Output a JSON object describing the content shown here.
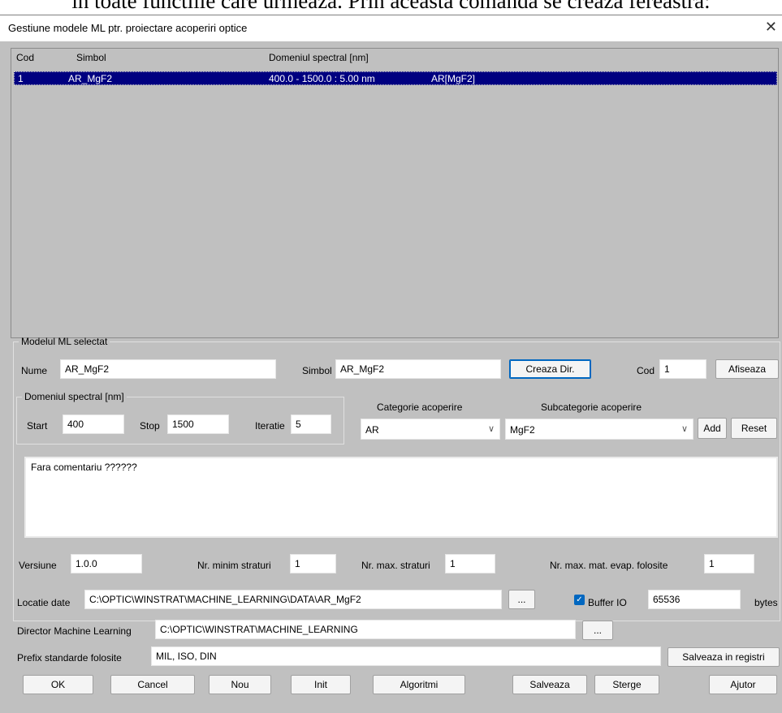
{
  "background_text": "in toate functiile care urmeaza. Prin aceasta comanda se creaza fereastra:",
  "window": {
    "title": "Gestiune modele ML ptr. proiectare acoperiri optice",
    "close_glyph": "✕"
  },
  "list": {
    "columns": [
      "Cod",
      "Simbol",
      "Domeniul spectral [nm]"
    ],
    "rows": [
      {
        "cod": "1",
        "simbol": "AR_MgF2",
        "domeniu": "400.0 - 1500.0 : 5.00 nm",
        "extra": "AR[MgF2]"
      }
    ]
  },
  "model": {
    "group_label": "Modelul ML selectat",
    "nume_label": "Nume",
    "nume_value": "AR_MgF2",
    "simbol_label": "Simbol",
    "simbol_value": "AR_MgF2",
    "creaza_dir": "Creaza Dir.",
    "cod_label": "Cod",
    "cod_value": "1",
    "afiseaza": "Afiseaza",
    "spectral": {
      "group_label": "Domeniul spectral [nm]",
      "start_label": "Start",
      "start_value": "400",
      "stop_label": "Stop",
      "stop_value": "1500",
      "iteratie_label": "Iteratie",
      "iteratie_value": "5"
    },
    "categorie_label": "Categorie acoperire",
    "categorie_value": "AR",
    "subcategorie_label": "Subcategorie acoperire",
    "subcategorie_value": "MgF2",
    "add": "Add",
    "reset": "Reset",
    "comment": "Fara comentariu ??????",
    "versiune_label": "Versiune",
    "versiune_value": "1.0.0",
    "min_straturi_label": "Nr. minim straturi",
    "min_straturi_value": "1",
    "max_straturi_label": "Nr. max. straturi",
    "max_straturi_value": "1",
    "max_mat_label": "Nr. max. mat. evap. folosite",
    "max_mat_value": "1"
  },
  "locatie": {
    "label": "Locatie date",
    "value": "C:\\OPTIC\\WINSTRAT\\MACHINE_LEARNING\\DATA\\AR_MgF2",
    "browse": "...",
    "buffer_label": "Buffer IO",
    "buffer_value": "65536",
    "bytes_label": "bytes"
  },
  "director": {
    "label": "Director Machine Learning",
    "value": "C:\\OPTIC\\WINSTRAT\\MACHINE_LEARNING",
    "browse": "..."
  },
  "prefix": {
    "label": "Prefix standarde folosite",
    "value": "MIL, ISO, DIN",
    "salveaza_registri": "Salveaza in registri"
  },
  "buttons": {
    "ok": "OK",
    "cancel": "Cancel",
    "nou": "Nou",
    "init": "Init",
    "algoritmi": "Algoritmi",
    "salveaza": "Salveaza",
    "sterge": "Sterge",
    "ajutor": "Ajutor"
  },
  "colors": {
    "selection": "#000080",
    "dialog_bg": "#c0c0c0",
    "accent": "#0067c0"
  }
}
